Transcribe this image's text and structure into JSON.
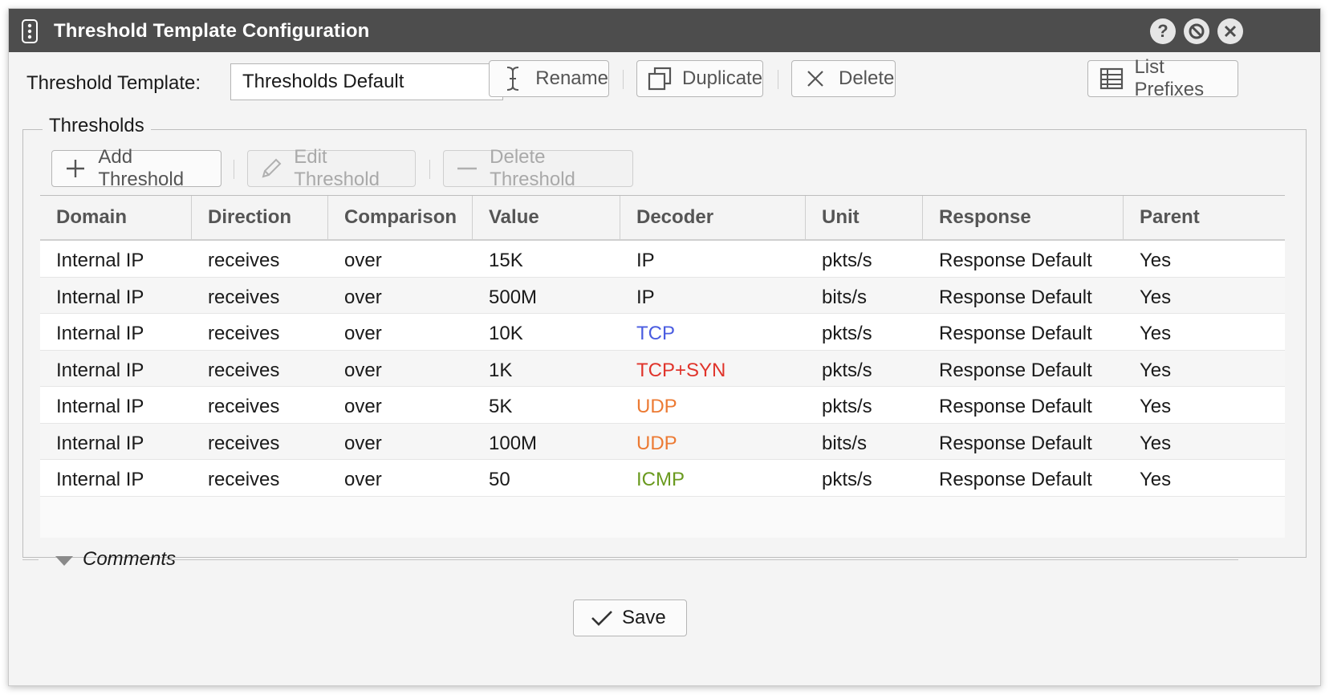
{
  "window": {
    "title": "Threshold Template Configuration",
    "icon": "traffic-light-icon"
  },
  "titlebar_buttons": [
    "help-icon",
    "minimize-icon",
    "close-icon"
  ],
  "template": {
    "label": "Threshold Template:",
    "value": "Thresholds Default",
    "rename_label": "Rename",
    "duplicate_label": "Duplicate",
    "delete_label": "Delete",
    "list_prefixes_label": "List Prefixes"
  },
  "thresholds": {
    "legend": "Thresholds",
    "add_label": "Add Threshold",
    "edit_label": "Edit Threshold",
    "delete_label": "Delete Threshold",
    "columns": [
      "Domain",
      "Direction",
      "Comparison",
      "Value",
      "Decoder",
      "Unit",
      "Response",
      "Parent"
    ],
    "rows": [
      {
        "domain": "Internal IP",
        "direction": "receives",
        "comparison": "over",
        "value": "15K",
        "decoder": "IP",
        "decoder_color": "#1a1a1a",
        "unit": "pkts/s",
        "response": "Response Default",
        "parent": "Yes"
      },
      {
        "domain": "Internal IP",
        "direction": "receives",
        "comparison": "over",
        "value": "500M",
        "decoder": "IP",
        "decoder_color": "#1a1a1a",
        "unit": "bits/s",
        "response": "Response Default",
        "parent": "Yes"
      },
      {
        "domain": "Internal IP",
        "direction": "receives",
        "comparison": "over",
        "value": "10K",
        "decoder": "TCP",
        "decoder_color": "#4a5ce0",
        "unit": "pkts/s",
        "response": "Response Default",
        "parent": "Yes"
      },
      {
        "domain": "Internal IP",
        "direction": "receives",
        "comparison": "over",
        "value": "1K",
        "decoder": "TCP+SYN",
        "decoder_color": "#e0342b",
        "unit": "pkts/s",
        "response": "Response Default",
        "parent": "Yes"
      },
      {
        "domain": "Internal IP",
        "direction": "receives",
        "comparison": "over",
        "value": "5K",
        "decoder": "UDP",
        "decoder_color": "#ec7a33",
        "unit": "pkts/s",
        "response": "Response Default",
        "parent": "Yes"
      },
      {
        "domain": "Internal IP",
        "direction": "receives",
        "comparison": "over",
        "value": "100M",
        "decoder": "UDP",
        "decoder_color": "#ec7a33",
        "unit": "bits/s",
        "response": "Response Default",
        "parent": "Yes"
      },
      {
        "domain": "Internal IP",
        "direction": "receives",
        "comparison": "over",
        "value": "50",
        "decoder": "ICMP",
        "decoder_color": "#6a9a1f",
        "unit": "pkts/s",
        "response": "Response Default",
        "parent": "Yes"
      }
    ]
  },
  "comments": {
    "label": "Comments"
  },
  "save_label": "Save"
}
